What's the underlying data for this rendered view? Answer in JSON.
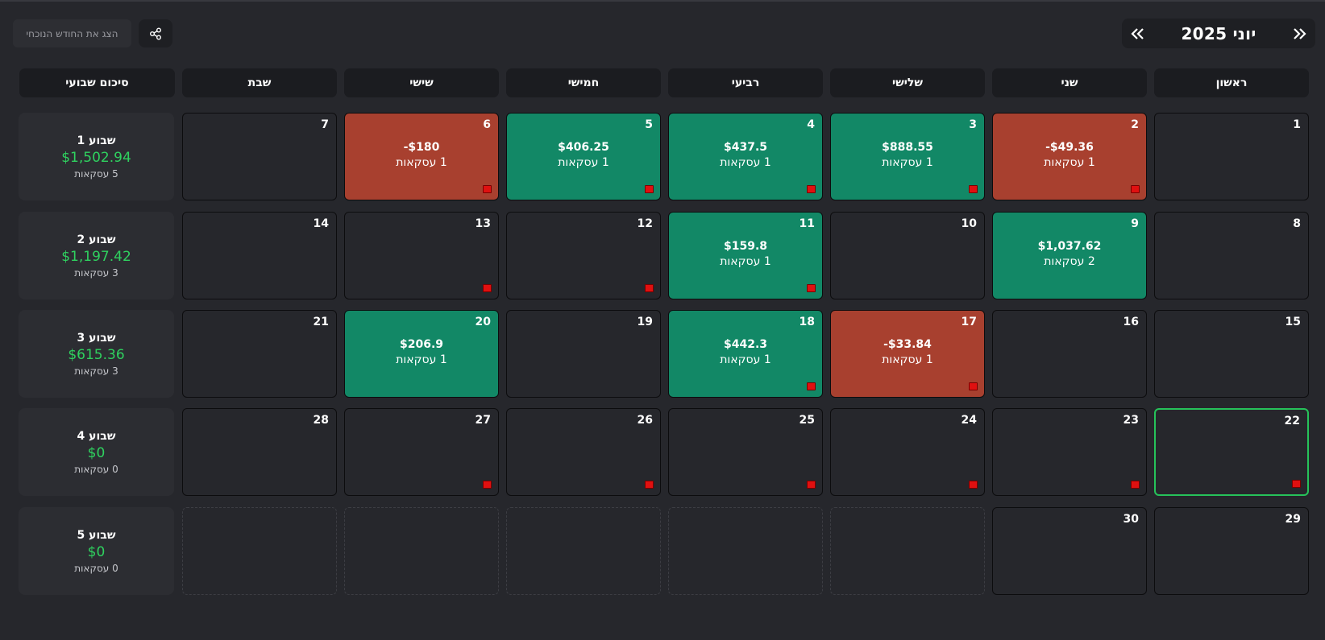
{
  "header": {
    "month_title": "יוני 2025",
    "show_current_label": "הצג את החודש הנוכחי"
  },
  "icons": {
    "prev": "chevrons-right-icon",
    "next": "chevrons-left-icon",
    "share": "share-icon",
    "note": "note-flag-icon"
  },
  "colors": {
    "win": "#128866",
    "loss": "#a8402f",
    "today_border": "#26c25a",
    "positive_text": "#2fd15f",
    "note_flag": "#e01010"
  },
  "weekday_headers": [
    "ראשון",
    "שני",
    "שלישי",
    "רביעי",
    "חמישי",
    "שישי",
    "שבת",
    "סיכום שבועי"
  ],
  "weeks": [
    {
      "title": "שבוע 1",
      "pnl": "$1,502.94",
      "trades": "5 עסקאות",
      "days": [
        {
          "num": "1"
        },
        {
          "num": "2",
          "pnl": "-$49.36",
          "trades": "1 עסקאות",
          "status": "loss",
          "note": true
        },
        {
          "num": "3",
          "pnl": "$888.55",
          "trades": "1 עסקאות",
          "status": "win",
          "note": true
        },
        {
          "num": "4",
          "pnl": "$437.5",
          "trades": "1 עסקאות",
          "status": "win",
          "note": true
        },
        {
          "num": "5",
          "pnl": "$406.25",
          "trades": "1 עסקאות",
          "status": "win",
          "note": true
        },
        {
          "num": "6",
          "pnl": "-$180",
          "trades": "1 עסקאות",
          "status": "loss",
          "note": true
        },
        {
          "num": "7"
        }
      ]
    },
    {
      "title": "שבוע 2",
      "pnl": "$1,197.42",
      "trades": "3 עסקאות",
      "days": [
        {
          "num": "8"
        },
        {
          "num": "9",
          "pnl": "$1,037.62",
          "trades": "2 עסקאות",
          "status": "win"
        },
        {
          "num": "10"
        },
        {
          "num": "11",
          "pnl": "$159.8",
          "trades": "1 עסקאות",
          "status": "win",
          "note": true
        },
        {
          "num": "12",
          "note": true
        },
        {
          "num": "13",
          "note": true
        },
        {
          "num": "14"
        }
      ]
    },
    {
      "title": "שבוע 3",
      "pnl": "$615.36",
      "trades": "3 עסקאות",
      "days": [
        {
          "num": "15"
        },
        {
          "num": "16"
        },
        {
          "num": "17",
          "pnl": "-$33.84",
          "trades": "1 עסקאות",
          "status": "loss",
          "note": true
        },
        {
          "num": "18",
          "pnl": "$442.3",
          "trades": "1 עסקאות",
          "status": "win",
          "note": true
        },
        {
          "num": "19"
        },
        {
          "num": "20",
          "pnl": "$206.9",
          "trades": "1 עסקאות",
          "status": "win"
        },
        {
          "num": "21"
        }
      ]
    },
    {
      "title": "שבוע 4",
      "pnl": "$0",
      "trades": "0 עסקאות",
      "days": [
        {
          "num": "22",
          "today": true,
          "note": true
        },
        {
          "num": "23",
          "note": true
        },
        {
          "num": "24",
          "note": true
        },
        {
          "num": "25",
          "note": true
        },
        {
          "num": "26",
          "note": true
        },
        {
          "num": "27",
          "note": true
        },
        {
          "num": "28"
        }
      ]
    },
    {
      "title": "שבוע 5",
      "pnl": "$0",
      "trades": "0 עסקאות",
      "days": [
        {
          "num": "29"
        },
        {
          "num": "30"
        },
        {
          "empty": true
        },
        {
          "empty": true
        },
        {
          "empty": true
        },
        {
          "empty": true
        },
        {
          "empty": true
        }
      ]
    }
  ]
}
